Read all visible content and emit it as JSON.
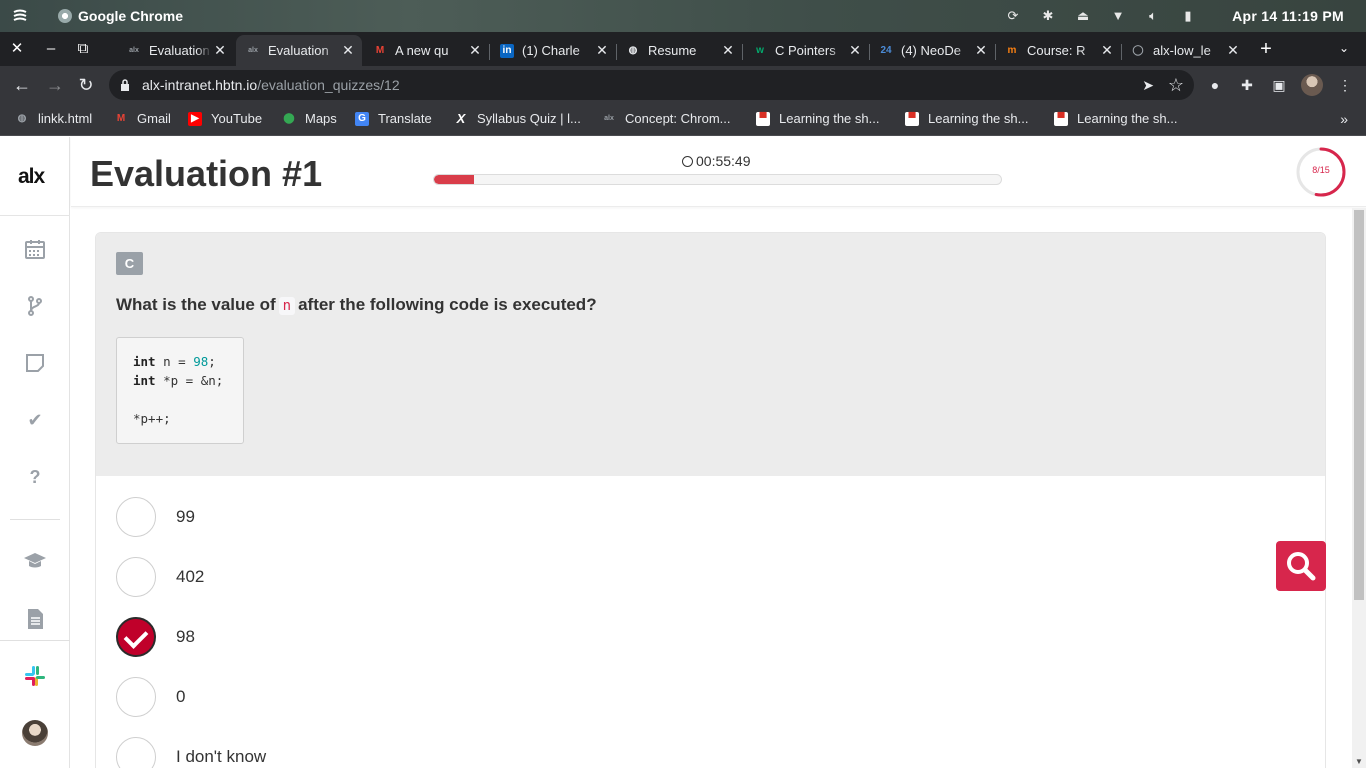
{
  "os": {
    "app_name": "Google Chrome",
    "clock": "Apr 14  11:19 PM"
  },
  "browser": {
    "tabs": [
      {
        "title": "Evaluation",
        "favicon": "alx-icon",
        "active": false
      },
      {
        "title": "Evaluation",
        "favicon": "alx-icon",
        "active": true
      },
      {
        "title": "A new qu",
        "favicon": "gmail-icon",
        "active": false
      },
      {
        "title": "(1) Charle",
        "favicon": "linkedin-icon",
        "active": false
      },
      {
        "title": "Resume",
        "favicon": "globe-icon",
        "active": false
      },
      {
        "title": "C Pointers",
        "favicon": "w3-icon",
        "active": false
      },
      {
        "title": "(4) NeoDe",
        "favicon": "24-icon",
        "active": false
      },
      {
        "title": "Course: R",
        "favicon": "moodle-icon",
        "active": false
      },
      {
        "title": "alx-low_le",
        "favicon": "github-icon",
        "active": false
      }
    ],
    "url_host": "alx-intranet.hbtn.io",
    "url_path": "/evaluation_quizzes/12",
    "bookmarks": [
      {
        "label": "linkk.html",
        "icon": "globe-icon"
      },
      {
        "label": "Gmail",
        "icon": "gmail-icon"
      },
      {
        "label": "YouTube",
        "icon": "youtube-icon"
      },
      {
        "label": "Maps",
        "icon": "maps-icon"
      },
      {
        "label": "Translate",
        "icon": "translate-icon"
      },
      {
        "label": "Syllabus Quiz | l...",
        "icon": "x-icon"
      },
      {
        "label": "Concept: Chrom...",
        "icon": "alx-icon"
      },
      {
        "label": "Learning the sh...",
        "icon": "page-icon"
      },
      {
        "label": "Learning the sh...",
        "icon": "page-icon"
      },
      {
        "label": "Learning the sh...",
        "icon": "page-icon"
      }
    ]
  },
  "app": {
    "logo": "alx",
    "title": "Evaluation #1",
    "timer": "00:55:49",
    "progress_fraction": 0.07,
    "question_counter": "8/15",
    "counter_fraction": 0.533,
    "accent": "#d7264c"
  },
  "question": {
    "tag": "C",
    "text_before": "What is the value of",
    "code_inline": "n",
    "text_after": "after the following code is executed?",
    "code_lines": [
      {
        "kw": "int",
        "rest": " n = ",
        "num": "98",
        "end": ";"
      },
      {
        "kw": "int",
        "rest": " *p = &n;",
        "num": "",
        "end": ""
      },
      {
        "kw": "",
        "rest": "",
        "num": "",
        "end": ""
      },
      {
        "kw": "",
        "rest": "*p++;",
        "num": "",
        "end": ""
      }
    ]
  },
  "answers": [
    {
      "label": "99",
      "checked": false
    },
    {
      "label": "402",
      "checked": false
    },
    {
      "label": "98",
      "checked": true
    },
    {
      "label": "0",
      "checked": false
    },
    {
      "label": "I don't know",
      "checked": false
    }
  ]
}
